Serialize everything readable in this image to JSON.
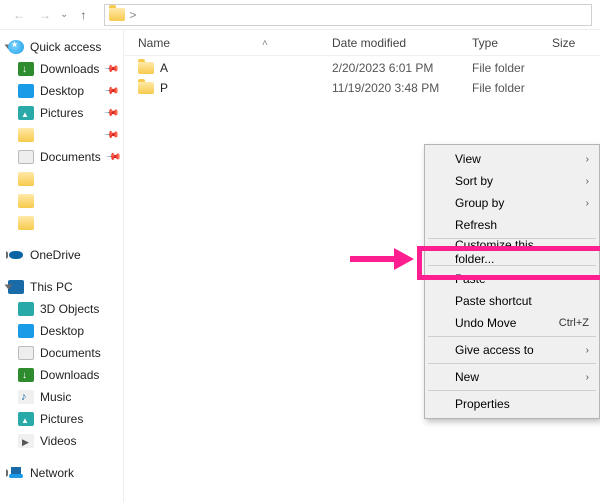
{
  "nav": {
    "back": "←",
    "fwd": "→",
    "up": "↑",
    "crumb_sep": ">"
  },
  "columns": {
    "name": "Name",
    "date": "Date modified",
    "type": "Type",
    "size": "Size",
    "sort_glyph": "˄"
  },
  "rows": [
    {
      "name": "A",
      "date": "2/20/2023 6:01 PM",
      "type": "File folder",
      "size": ""
    },
    {
      "name": "P",
      "date": "11/19/2020 3:48 PM",
      "type": "File folder",
      "size": ""
    }
  ],
  "sidebar": {
    "quick": {
      "label": "Quick access"
    },
    "dl": {
      "label": "Downloads"
    },
    "dt": {
      "label": "Desktop"
    },
    "pic": {
      "label": "Pictures"
    },
    "doc": {
      "label": "Documents"
    },
    "od": {
      "label": "OneDrive"
    },
    "pc": {
      "label": "This PC"
    },
    "obj": {
      "label": "3D Objects"
    },
    "dt2": {
      "label": "Desktop"
    },
    "doc2": {
      "label": "Documents"
    },
    "dl2": {
      "label": "Downloads"
    },
    "mus": {
      "label": "Music"
    },
    "pic2": {
      "label": "Pictures"
    },
    "vid": {
      "label": "Videos"
    },
    "net": {
      "label": "Network"
    }
  },
  "ctx": {
    "view": "View",
    "sort": "Sort by",
    "group": "Group by",
    "refresh": "Refresh",
    "custom": "Customize this folder...",
    "paste": "Paste",
    "paste_sc": "Paste shortcut",
    "undo": "Undo Move",
    "undo_key": "Ctrl+Z",
    "give": "Give access to",
    "new": "New",
    "props": "Properties",
    "sub_glyph": "›"
  }
}
